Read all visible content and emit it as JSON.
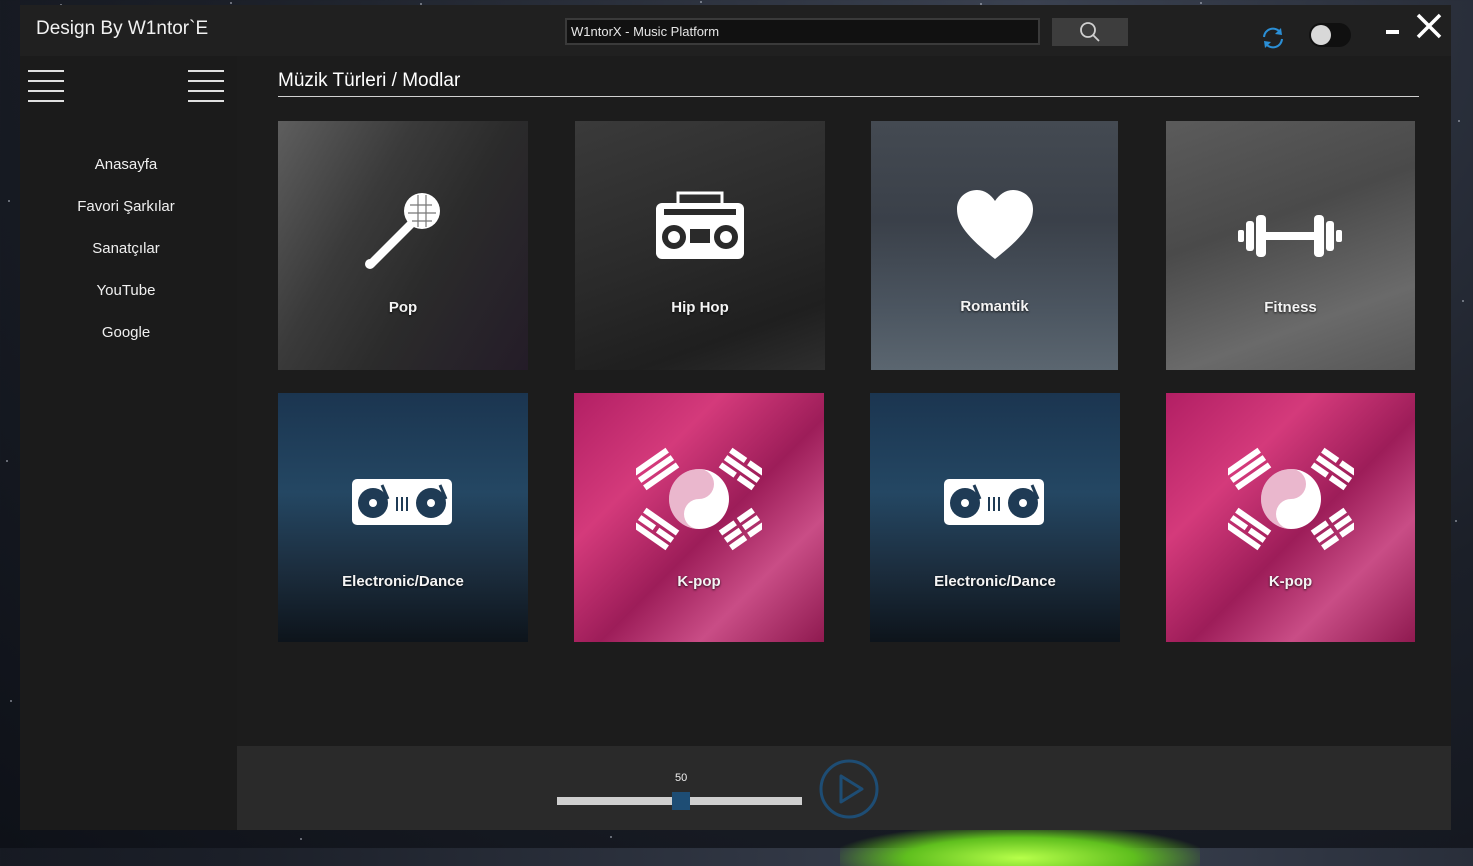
{
  "window": {
    "title": "Design By W1ntor`E",
    "search_value": "W1ntorX - Music Platform"
  },
  "sidebar": {
    "items": [
      {
        "label": "Anasayfa"
      },
      {
        "label": "Favori Şarkılar"
      },
      {
        "label": "Sanatçılar"
      },
      {
        "label": "YouTube"
      },
      {
        "label": "Google"
      }
    ]
  },
  "main": {
    "section_title": "Müzik Türleri / Modlar",
    "tiles": [
      {
        "label": "Pop",
        "icon": "microphone-icon"
      },
      {
        "label": "Hip Hop",
        "icon": "boombox-icon"
      },
      {
        "label": "Romantik",
        "icon": "heart-icon"
      },
      {
        "label": "Fitness",
        "icon": "dumbbell-icon"
      },
      {
        "label": "Electronic/Dance",
        "icon": "turntable-icon"
      },
      {
        "label": "K-pop",
        "icon": "korean-flag-icon"
      },
      {
        "label": "Electronic/Dance",
        "icon": "turntable-icon"
      },
      {
        "label": "K-pop",
        "icon": "korean-flag-icon"
      }
    ]
  },
  "player": {
    "volume_label": "50",
    "volume": 50
  },
  "colors": {
    "accent": "#1e4d74",
    "refresh": "#2b8fd6",
    "kpop": "#c2306f"
  }
}
